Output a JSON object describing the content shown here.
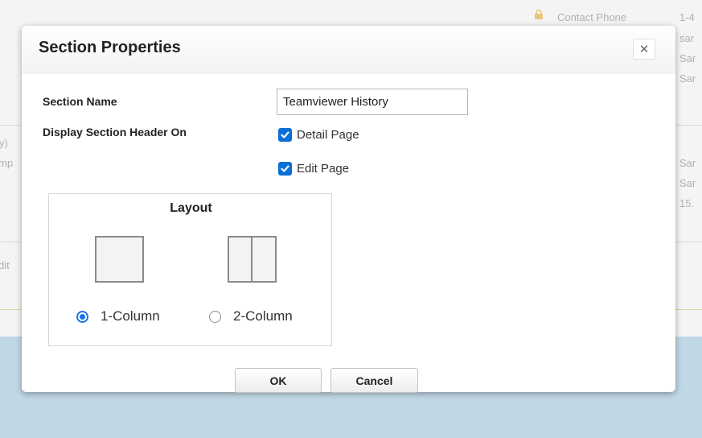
{
  "background": {
    "contact_phone_label": "Contact Phone",
    "right_fragments": [
      "1-4",
      "sar",
      "Sar",
      "Sar",
      "Sar",
      "Sar",
      "15."
    ],
    "left_fragments": [
      "y)",
      "mp",
      "dit"
    ]
  },
  "dialog": {
    "title": "Section Properties",
    "close_symbol": "✕",
    "section_name": {
      "label": "Section Name",
      "value": "Teamviewer History"
    },
    "display_header": {
      "label": "Display Section Header On",
      "options": [
        {
          "label": "Detail Page",
          "checked": true
        },
        {
          "label": "Edit Page",
          "checked": true
        }
      ]
    },
    "layout": {
      "title": "Layout",
      "options": [
        {
          "label": "1-Column",
          "selected": true,
          "icon": "single-column-icon"
        },
        {
          "label": "2-Column",
          "selected": false,
          "icon": "two-column-icon"
        }
      ]
    },
    "ok_label": "OK",
    "cancel_label": "Cancel"
  },
  "colors": {
    "accent": "#0a6fd6",
    "overlay_bottom": "#c0d8e5"
  }
}
